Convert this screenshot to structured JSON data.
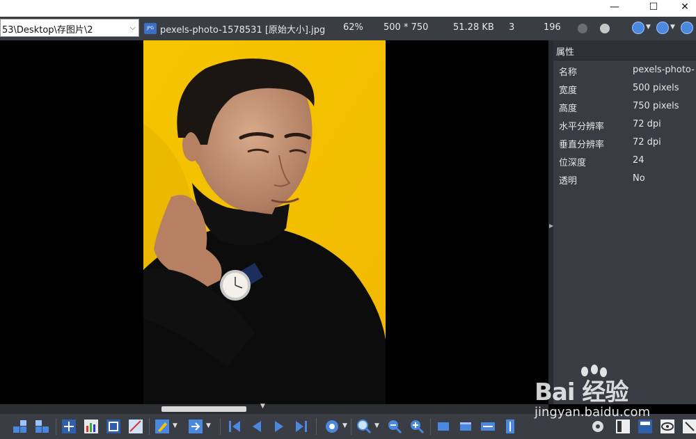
{
  "window": {
    "min_icon": "minimize-icon",
    "max_icon": "maximize-icon",
    "close_icon": "close-icon"
  },
  "infobar": {
    "path": "53\\Desktop\\存图片\\2",
    "file_name": "pexels-photo-1578531 [原始大小].jpg",
    "zoom": "62%",
    "dimensions": "500 * 750",
    "file_size": "51.28 KB",
    "count": "3",
    "value": "196"
  },
  "properties": {
    "header": "属性",
    "rows": [
      {
        "key": "名称",
        "value": "pexels-photo-"
      },
      {
        "key": "宽度",
        "value": "500 pixels"
      },
      {
        "key": "高度",
        "value": "750 pixels"
      },
      {
        "key": "水平分辨率",
        "value": "72 dpi"
      },
      {
        "key": "垂直分辨率",
        "value": "72 dpi"
      },
      {
        "key": "位深度",
        "value": "24"
      },
      {
        "key": "透明",
        "value": "No"
      }
    ]
  },
  "watermark": {
    "brand": "Bai  经验",
    "url": "jingyan.baidu.com"
  },
  "colors": {
    "accent": "#4a88e0",
    "photo_bg": "#f5c400",
    "panel": "#3a3c43"
  }
}
